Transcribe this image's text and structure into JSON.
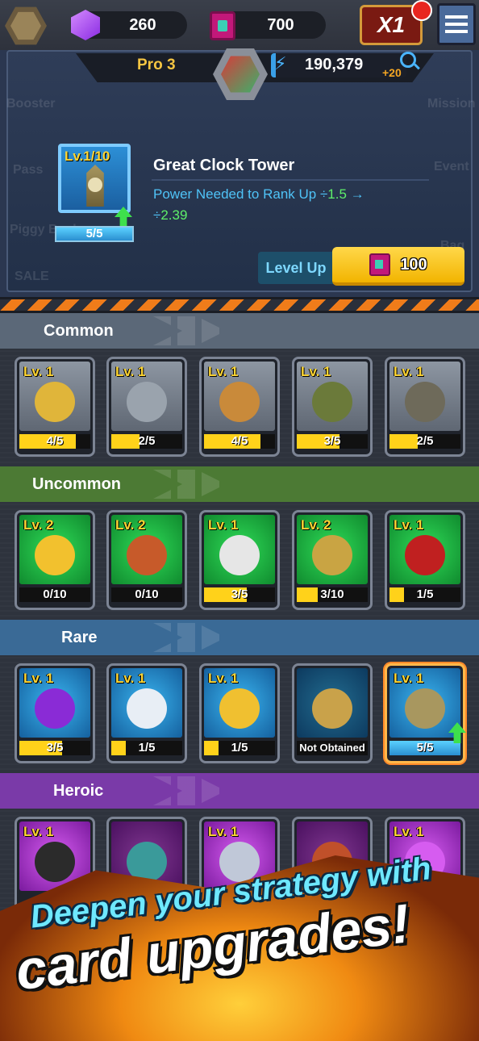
{
  "top_bar": {
    "gems": "260",
    "books": "700",
    "speed": "X1"
  },
  "info_panel": {
    "rank": "Pro 3",
    "power": "190,379",
    "power_bonus": "+20",
    "ghost_labels": [
      "Booster",
      "Pass",
      "Piggy Bank",
      "SALE",
      "Mission",
      "Event",
      "Bag"
    ],
    "selected_card": {
      "level": "Lv.1/10",
      "progress": "5/5",
      "progress_fraction": 1.0,
      "name": "Great Clock Tower",
      "desc_prefix": "Power Needed to Rank Up ÷",
      "desc_from": "1.5",
      "desc_arrow": "→",
      "desc_div": "÷",
      "desc_to": "2.39"
    },
    "level_up_label": "Level Up",
    "level_up_cost": "100"
  },
  "sections": [
    {
      "title": "Common",
      "color": "#5b6878",
      "cards": [
        {
          "level": "Lv. 1",
          "progress": "4/5",
          "fill": 0.8
        },
        {
          "level": "Lv. 1",
          "progress": "2/5",
          "fill": 0.4
        },
        {
          "level": "Lv. 1",
          "progress": "4/5",
          "fill": 0.8
        },
        {
          "level": "Lv. 1",
          "progress": "3/5",
          "fill": 0.6
        },
        {
          "level": "Lv. 1",
          "progress": "2/5",
          "fill": 0.4
        }
      ]
    },
    {
      "title": "Uncommon",
      "color": "#4c7a34",
      "cards": [
        {
          "level": "Lv. 2",
          "progress": "0/10",
          "fill": 0.0
        },
        {
          "level": "Lv. 2",
          "progress": "0/10",
          "fill": 0.0
        },
        {
          "level": "Lv. 1",
          "progress": "3/5",
          "fill": 0.6
        },
        {
          "level": "Lv. 2",
          "progress": "3/10",
          "fill": 0.3
        },
        {
          "level": "Lv. 1",
          "progress": "1/5",
          "fill": 0.2
        }
      ]
    },
    {
      "title": "Rare",
      "color": "#3a6a96",
      "cards": [
        {
          "level": "Lv. 1",
          "progress": "3/5",
          "fill": 0.6
        },
        {
          "level": "Lv. 1",
          "progress": "1/5",
          "fill": 0.2
        },
        {
          "level": "Lv. 1",
          "progress": "1/5",
          "fill": 0.2
        },
        {
          "level": "",
          "progress": "Not Obtained",
          "fill": 0.0
        },
        {
          "level": "Lv. 1",
          "progress": "5/5",
          "fill": 1.0
        }
      ]
    },
    {
      "title": "Heroic",
      "color": "#7a3aa8",
      "cards": [
        {
          "level": "Lv. 1"
        },
        {
          "level": ""
        },
        {
          "level": "Lv. 1"
        },
        {
          "level": ""
        },
        {
          "level": "Lv. 1"
        }
      ]
    }
  ],
  "promo": {
    "line1": "Deepen your strategy with",
    "line2": "card upgrades!"
  }
}
